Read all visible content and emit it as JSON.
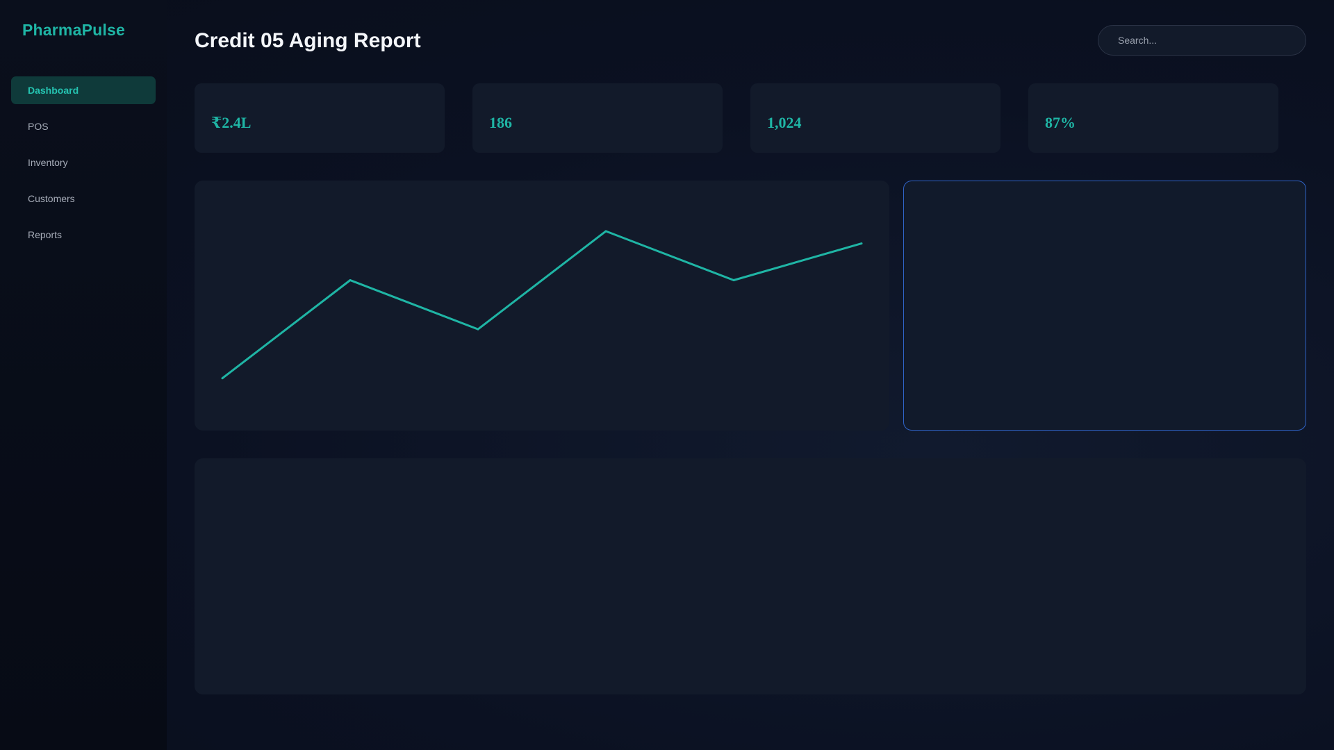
{
  "app": {
    "name": "PharmaPulse"
  },
  "sidebar": {
    "items": [
      {
        "label": "Dashboard",
        "active": true
      },
      {
        "label": "POS",
        "active": false
      },
      {
        "label": "Inventory",
        "active": false
      },
      {
        "label": "Customers",
        "active": false
      },
      {
        "label": "Reports",
        "active": false
      }
    ]
  },
  "header": {
    "title": "Credit 05 Aging Report",
    "search_placeholder": "Search..."
  },
  "stats": [
    {
      "value": "₹2.4L"
    },
    {
      "value": "186"
    },
    {
      "value": "1,024"
    },
    {
      "value": "87%"
    }
  ],
  "colors": {
    "accent": "#1fb5a5",
    "panel": "#121a2a",
    "highlight_border": "#2f63c7"
  },
  "chart_data": {
    "type": "line",
    "title": "",
    "xlabel": "",
    "ylabel": "",
    "grid": false,
    "x": [
      1,
      2,
      3,
      4,
      5,
      6
    ],
    "series": [
      {
        "values": [
          1.0,
          5.0,
          3.0,
          7.0,
          5.0,
          6.5
        ],
        "color": "#1fb5a5"
      }
    ],
    "ylim": [
      0,
      8.5
    ]
  }
}
